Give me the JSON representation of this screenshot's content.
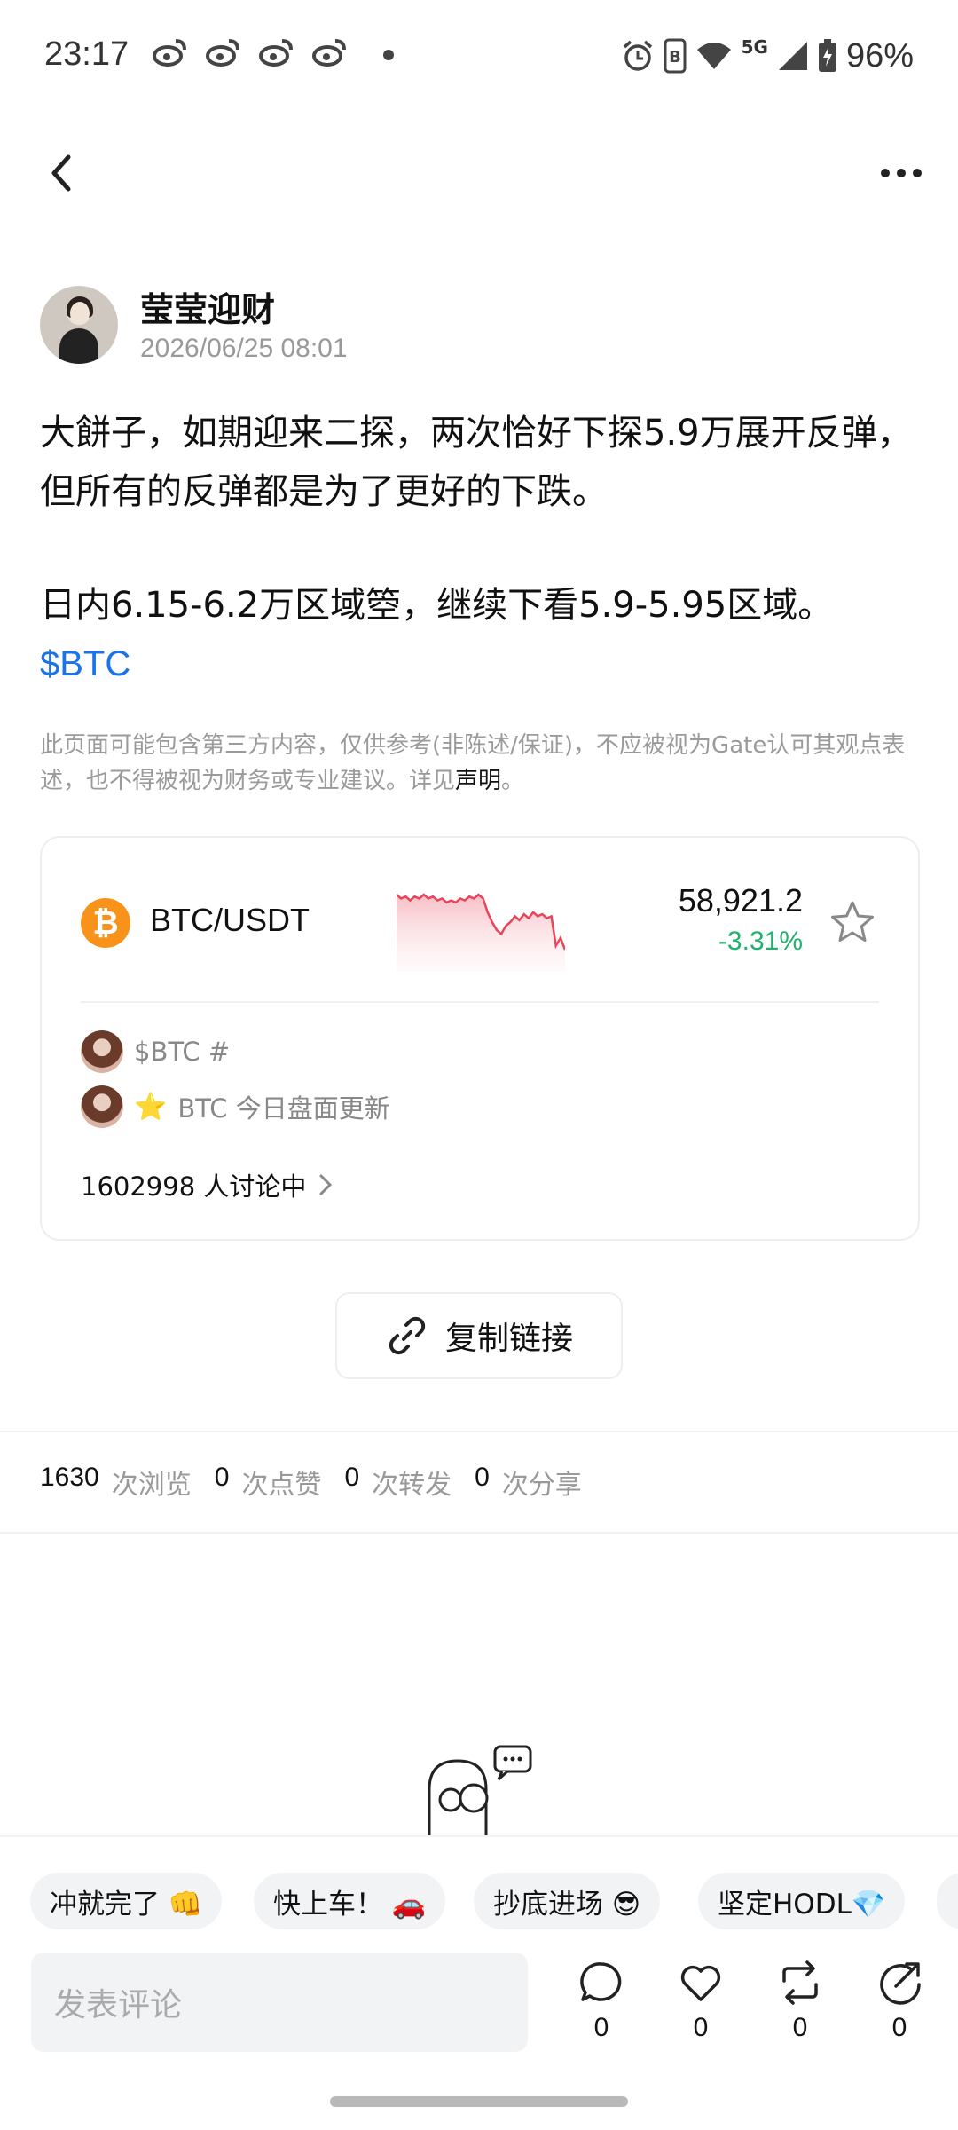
{
  "status_bar": {
    "time": "23:17",
    "network": "5G",
    "battery": "96%"
  },
  "author": {
    "name": "莹莹迎财",
    "time": "2026/06/25 08:01"
  },
  "post": {
    "paragraph1": "大餅子，如期迎来二探，两次恰好下探5.9万展开反弹，但所有的反弹都是为了更好的下跌。",
    "paragraph2": "日内6.15-6.2万区域箜，继续下看5.9-5.95区域。",
    "ticker": "$BTC"
  },
  "disclaimer": {
    "text": "此页面可能包含第三方内容，仅供参考(非陈述/保证)，不应被视为Gate认可其观点表述，也不得被视为财务或专业建议。详见",
    "link": "声明",
    "end": "。"
  },
  "market_card": {
    "coin_symbol": "₿",
    "pair": "BTC/USDT",
    "price": "58,921.2",
    "change": "-3.31%",
    "topic1": "$BTC #",
    "topic2_icon": "⭐",
    "topic2": "BTC 今日盘面更新",
    "discussion": "1602998 人讨论中"
  },
  "chart_data": {
    "type": "line",
    "title": "",
    "series": [
      {
        "values": [
          64,
          62,
          63,
          61,
          63,
          62,
          64,
          62,
          63,
          61,
          62,
          60,
          61,
          60,
          62,
          61,
          63,
          62,
          64,
          62,
          55,
          50,
          46,
          44,
          48,
          50,
          53,
          51,
          54,
          52,
          55,
          53,
          54,
          52,
          53,
          38,
          42,
          36
        ]
      }
    ],
    "color": "#e8455a"
  },
  "copy_link": {
    "label": "复制链接"
  },
  "stats": [
    {
      "value": "1630",
      "label": "次浏览"
    },
    {
      "value": "0",
      "label": "次点赞"
    },
    {
      "value": "0",
      "label": "次转发"
    },
    {
      "value": "0",
      "label": "次分享"
    }
  ],
  "quick_reactions": [
    "冲就完了 👊",
    "快上车！ 🚗",
    "抄底进场 😎",
    "坚定HODL💎"
  ],
  "comment_bar": {
    "placeholder": "发表评论",
    "actions": [
      {
        "icon": "comment-icon",
        "count": "0"
      },
      {
        "icon": "heart-icon",
        "count": "0"
      },
      {
        "icon": "repost-icon",
        "count": "0"
      },
      {
        "icon": "share-icon",
        "count": "0"
      }
    ]
  },
  "colors": {
    "accent_link": "#1a73e8",
    "positive_change": "#20b26c",
    "btc_orange": "#f7931a"
  }
}
